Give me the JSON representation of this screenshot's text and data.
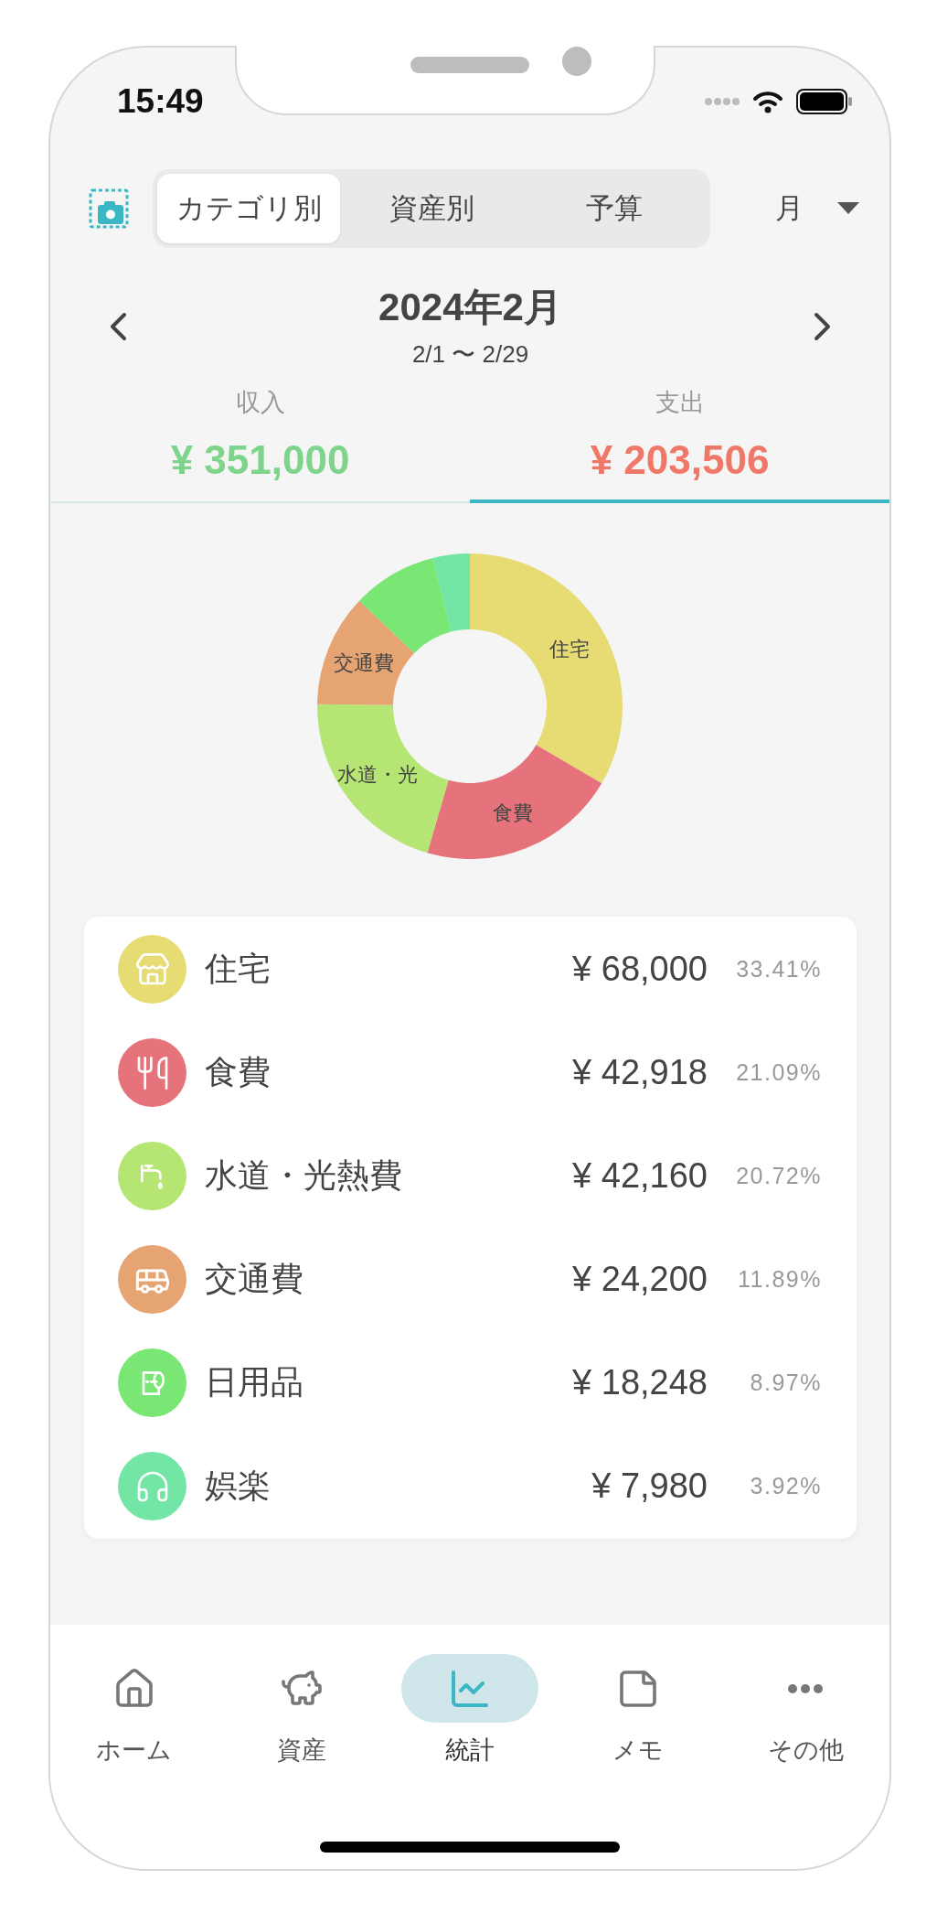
{
  "status_bar": {
    "time": "15:49"
  },
  "toolbar": {
    "segments": [
      {
        "label": "カテゴリ別",
        "selected": true
      },
      {
        "label": "資産別",
        "selected": false
      },
      {
        "label": "予算",
        "selected": false
      }
    ],
    "period": "月"
  },
  "period_header": {
    "title": "2024年2月",
    "range": "2/1 〜 2/29"
  },
  "summary": [
    {
      "label": "収入",
      "amount": "¥ 351,000",
      "color": "#7dd48a",
      "selected": false
    },
    {
      "label": "支出",
      "amount": "¥ 203,506",
      "color": "#f07868",
      "selected": true
    }
  ],
  "chart": {
    "chart_data": {
      "type": "donut",
      "categories": [
        "住宅",
        "食費",
        "水道・光",
        "交通費",
        null,
        null
      ],
      "values": [
        33.41,
        21.09,
        20.72,
        11.89,
        8.97,
        3.92
      ]
    }
  },
  "categories": [
    {
      "kind": "housing",
      "name": "住宅",
      "amount": "¥ 68,000",
      "share": "33.41%",
      "color": "#e6dc73"
    },
    {
      "kind": "food",
      "name": "食費",
      "amount": "¥ 42,918",
      "share": "21.09%",
      "color": "#e6737b"
    },
    {
      "kind": "utilities",
      "name": "水道・光熱費",
      "amount": "¥ 42,160",
      "share": "20.72%",
      "color": "#b5e673"
    },
    {
      "kind": "transport",
      "name": "交通費",
      "amount": "¥ 24,200",
      "share": "11.89%",
      "color": "#e6a473"
    },
    {
      "kind": "daily",
      "name": "日用品",
      "amount": "¥ 18,248",
      "share": "8.97%",
      "color": "#7ae673"
    },
    {
      "kind": "leisure",
      "name": "娯楽",
      "amount": "¥ 7,980",
      "share": "3.92%",
      "color": "#73e6a5"
    }
  ],
  "nav": [
    {
      "kind": "home",
      "label": "ホーム",
      "selected": false
    },
    {
      "kind": "assets",
      "label": "資産",
      "selected": false
    },
    {
      "kind": "stats",
      "label": "統計",
      "selected": true
    },
    {
      "kind": "memo",
      "label": "メモ",
      "selected": false
    },
    {
      "kind": "more",
      "label": "その他",
      "selected": false
    }
  ]
}
